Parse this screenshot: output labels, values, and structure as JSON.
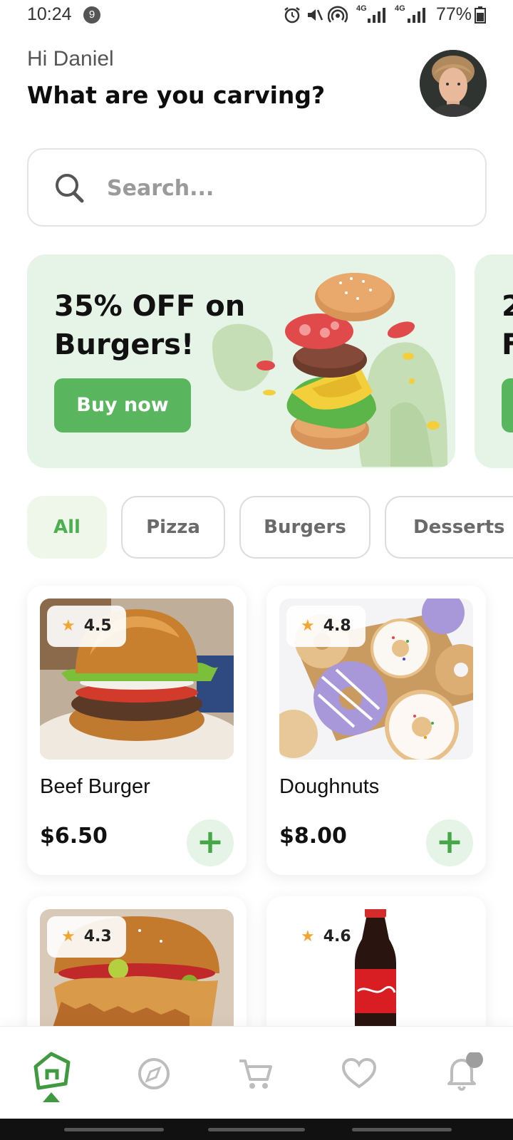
{
  "status_bar": {
    "time": "10:24",
    "notification_count": "9",
    "battery": "77%",
    "network_label_1": "4G",
    "network_label_2": "4G"
  },
  "header": {
    "greeting": "Hi Daniel",
    "headline": "What are you carving?"
  },
  "search": {
    "placeholder": "Search..."
  },
  "promo": {
    "title": "35% OFF on Burgers!",
    "button_label": "Buy now",
    "next_title_peek": "2 F",
    "background_color": "#e6f4e7",
    "button_color": "#5ab65e"
  },
  "categories": [
    {
      "label": "All",
      "active": true
    },
    {
      "label": "Pizza",
      "active": false
    },
    {
      "label": "Burgers",
      "active": false
    },
    {
      "label": "Desserts",
      "active": false
    }
  ],
  "products": [
    {
      "name": "Beef Burger",
      "price": "$6.50",
      "rating": "4.5",
      "add_label": "+"
    },
    {
      "name": "Doughnuts",
      "price": "$8.00",
      "rating": "4.8",
      "add_label": "+"
    },
    {
      "name": "",
      "price": "",
      "rating": "4.3",
      "add_label": ""
    },
    {
      "name": "",
      "price": "",
      "rating": "4.6",
      "add_label": ""
    }
  ],
  "bottom_nav": {
    "items": [
      "home-icon",
      "compass-icon",
      "cart-icon",
      "heart-icon",
      "bell-icon"
    ],
    "active": "home-icon",
    "accent_color": "#3f9a40"
  },
  "colors": {
    "accent": "#4caf50",
    "rating_star": "#f3a534"
  }
}
